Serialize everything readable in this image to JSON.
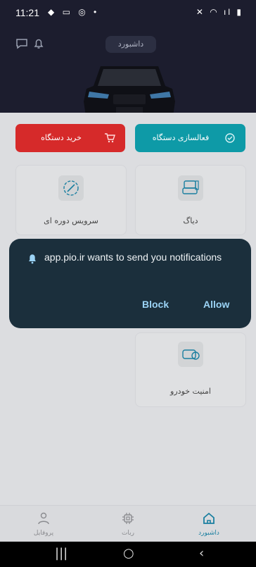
{
  "status_bar": {
    "time": "11:21",
    "left_icons": "◆ ▭ ◎ •",
    "right_icons": "✕ ◠ ıl ▮"
  },
  "header": {
    "title": "داشبورد"
  },
  "actions": {
    "activate_label": "فعالسازی دستگاه",
    "buy_label": "خرید دستگاه",
    "activate_color": "#0e9aa7",
    "buy_color": "#d62a2a"
  },
  "cards": [
    {
      "label": "دیاگ"
    },
    {
      "label": "سرویس دوره ای"
    },
    {
      "label": "امنیت خودرو"
    }
  ],
  "dialog": {
    "message": "app.pio.ir wants to send you notifications",
    "block_label": "Block",
    "allow_label": "Allow"
  },
  "bottom_nav": {
    "dashboard": "داشبورد",
    "robot": "ربات",
    "profile": "پروفایل",
    "active_color": "#1a7fa0"
  },
  "system_nav": {
    "recents": "|||",
    "home": "○",
    "back": "‹"
  }
}
